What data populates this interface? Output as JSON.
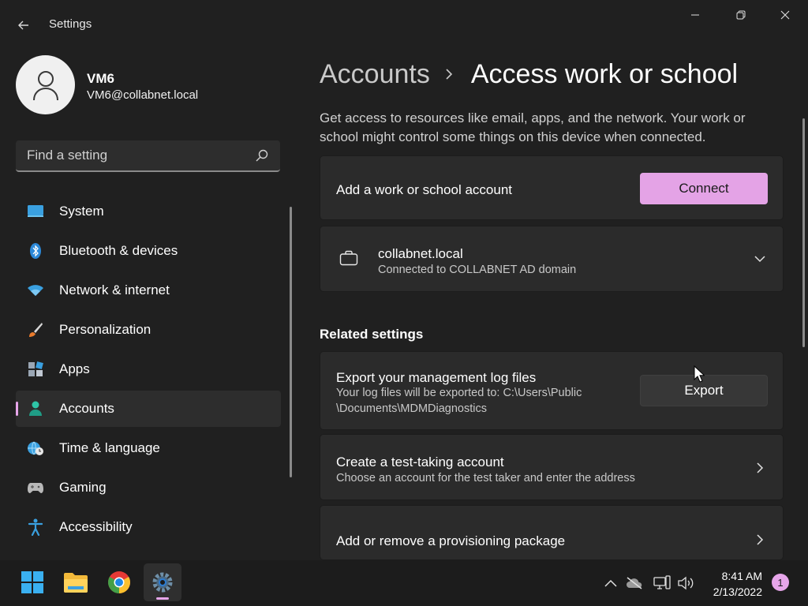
{
  "window": {
    "title": "Settings"
  },
  "profile": {
    "name": "VM6",
    "email": "VM6@collabnet.local"
  },
  "search": {
    "placeholder": "Find a setting"
  },
  "sidebar": {
    "items": [
      {
        "label": "System",
        "icon": "system-icon",
        "active": false
      },
      {
        "label": "Bluetooth & devices",
        "icon": "bluetooth-icon",
        "active": false
      },
      {
        "label": "Network & internet",
        "icon": "wifi-icon",
        "active": false
      },
      {
        "label": "Personalization",
        "icon": "brush-icon",
        "active": false
      },
      {
        "label": "Apps",
        "icon": "apps-icon",
        "active": false
      },
      {
        "label": "Accounts",
        "icon": "accounts-icon",
        "active": true
      },
      {
        "label": "Time & language",
        "icon": "globe-clock-icon",
        "active": false
      },
      {
        "label": "Gaming",
        "icon": "gamepad-icon",
        "active": false
      },
      {
        "label": "Accessibility",
        "icon": "accessibility-icon",
        "active": false
      }
    ]
  },
  "header": {
    "parent": "Accounts",
    "current": "Access work or school"
  },
  "main": {
    "description": "Get access to resources like email, apps, and the network. Your work or school might control some things on this device when connected.",
    "add_account": {
      "label": "Add a work or school account",
      "button": "Connect"
    },
    "connected_account": {
      "title": "collabnet.local",
      "subtitle": "Connected to COLLABNET AD domain"
    },
    "related_heading": "Related settings",
    "export_logs": {
      "title": "Export your management log files",
      "subtitle_line1": "Your log files will be exported to: C:\\Users\\Public",
      "subtitle_line2": "\\Documents\\MDMDiagnostics",
      "button": "Export"
    },
    "test_account": {
      "title": "Create a test-taking account",
      "subtitle": "Choose an account for the test taker and enter the address"
    },
    "provisioning": {
      "title": "Add or remove a provisioning package"
    }
  },
  "taskbar": {
    "apps": [
      "windows-start-icon",
      "file-explorer-icon",
      "chrome-icon",
      "settings-icon"
    ],
    "time": "8:41 AM",
    "date": "2/13/2022",
    "notification_count": "1"
  },
  "colors": {
    "accent": "#e4a3e6",
    "background": "#202020",
    "card": "#2b2b2b"
  }
}
